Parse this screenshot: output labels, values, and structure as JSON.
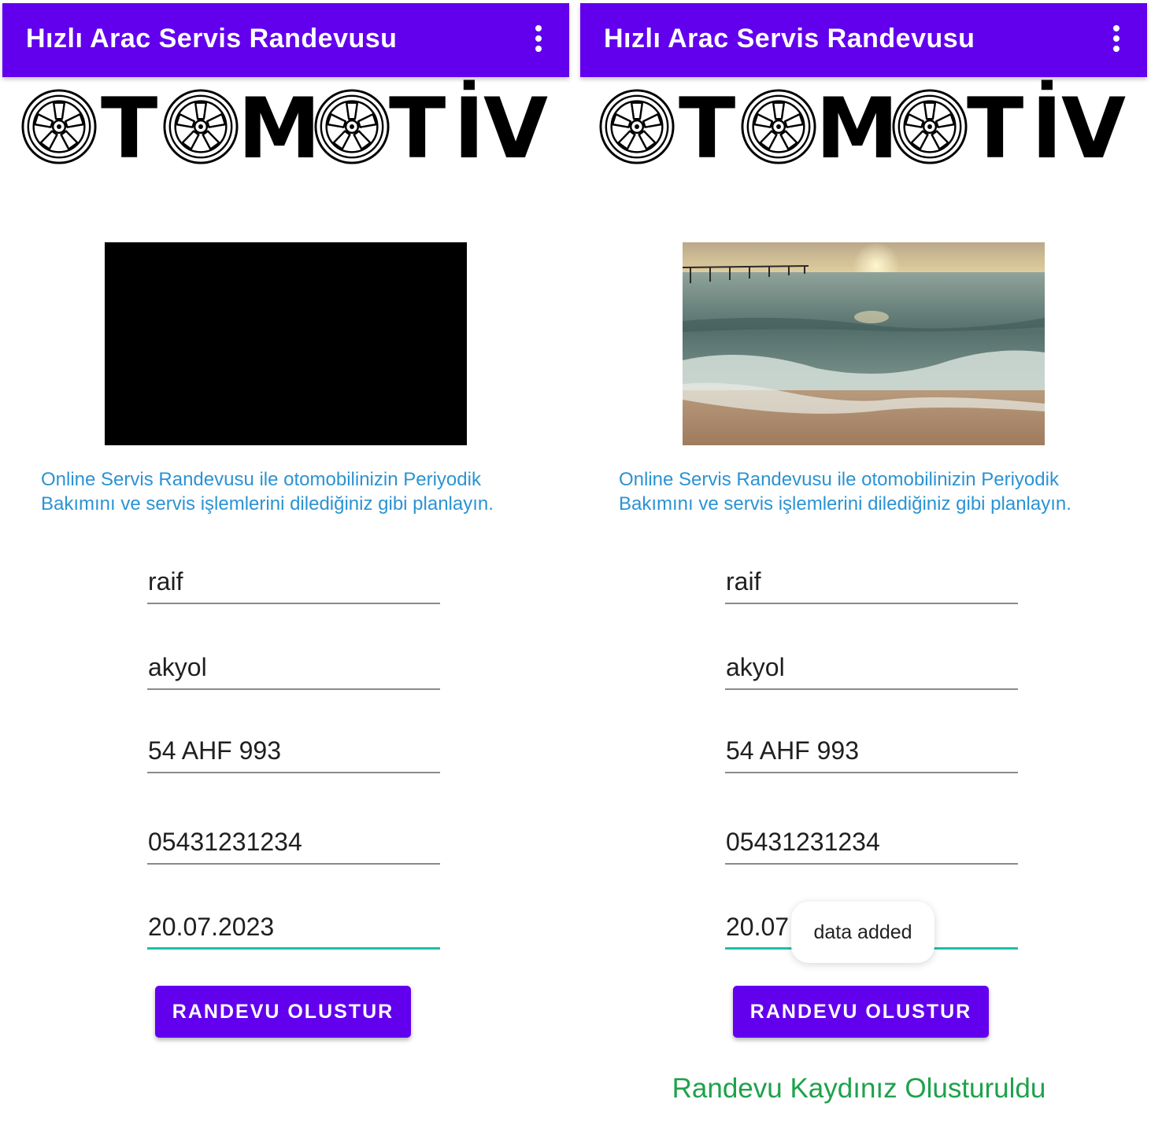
{
  "app": {
    "title": "Hızlı Arac Servis Randevusu",
    "logo_text": "OTOMOTİV",
    "accent_color": "#6200ee",
    "focus_color": "#1dbfad",
    "description": "Online Servis Randevusu ile otomobilinizin Periyodik Bakımını ve servis işlemlerini dilediğiniz gibi planlayın.",
    "menu_icon": "more-vert-icon"
  },
  "form": {
    "first_name": "raif",
    "last_name": "akyol",
    "plate": "54 AHF 993",
    "phone": "05431231234",
    "date": "20.07.2023",
    "submit_label": "RANDEVU OLUSTUR"
  },
  "left_panel": {
    "video_state": "black"
  },
  "right_panel": {
    "video_state": "beach-sunset",
    "toast": "data added",
    "status_message": "Randevu Kaydınız Olusturuldu",
    "status_color": "#1ea24b"
  }
}
